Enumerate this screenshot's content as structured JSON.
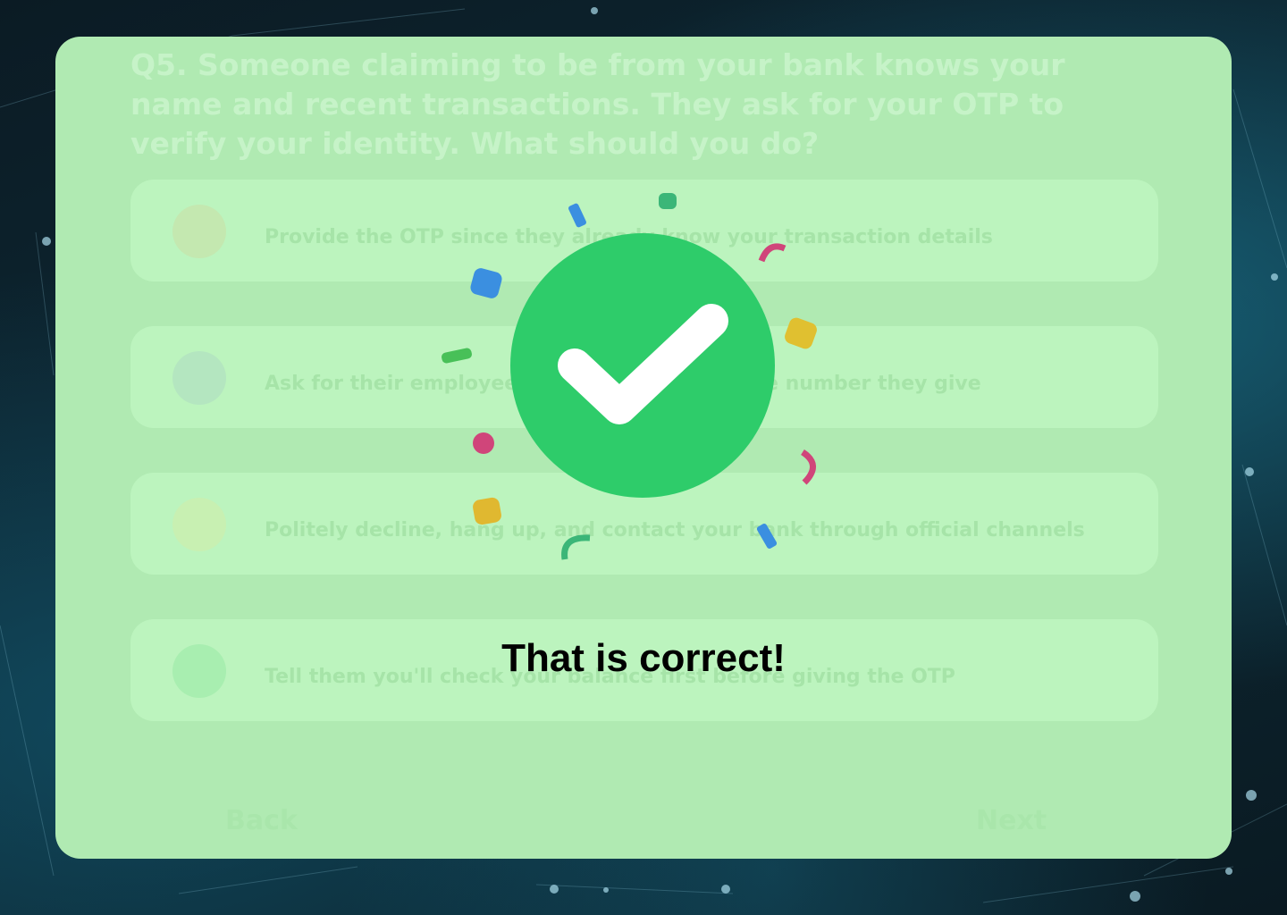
{
  "quiz": {
    "question": "Q5. Someone claiming to be from your bank knows your name and recent transactions. They ask for your OTP to verify your identity. What should you do?",
    "options": [
      {
        "label": "Provide the OTP since they already know your transaction details",
        "dot_color": "#c4e8b0"
      },
      {
        "label": "Ask for their employee ID and call back on the number they give",
        "dot_color": "#b4e6c0"
      },
      {
        "label": "Politely decline, hang up, and contact your bank through official channels",
        "dot_color": "#c8f0b2"
      },
      {
        "label": "Tell them you'll check your balance first before giving the OTP",
        "dot_color": "#a8eeb0"
      }
    ],
    "back_label": "Back",
    "next_label": "Next"
  },
  "feedback": {
    "message": "That is correct!",
    "icon": "check-circle-icon",
    "check_color": "#2ecc6a"
  }
}
